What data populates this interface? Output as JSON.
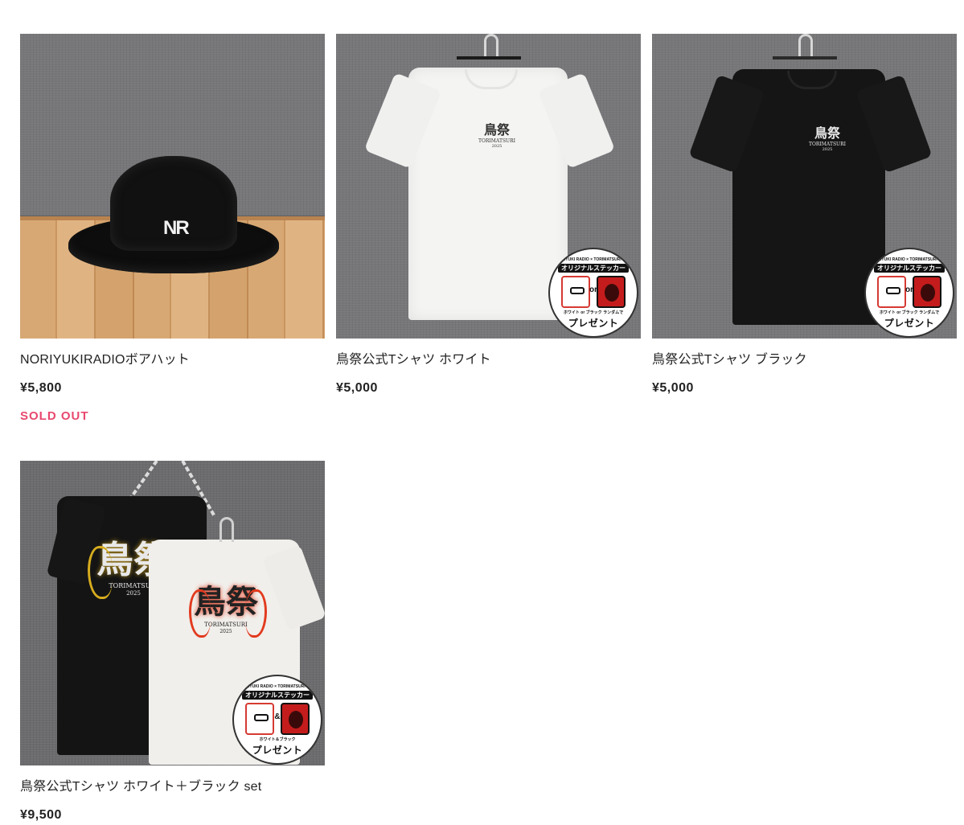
{
  "products": [
    {
      "title": "NORIYUKIRADIOボアハット",
      "price": "¥5,800",
      "status": "SOLD OUT",
      "image": {
        "hat_logo": "NR"
      }
    },
    {
      "title": "鳥祭公式Tシャツ ホワイト",
      "price": "¥5,000",
      "image": {
        "print_kanji": "鳥祭",
        "print_text": "TORIMATSURI",
        "print_year": "2025",
        "sticker": {
          "top": "NORIYUKI RADIO × TORIMATSURI 2025",
          "title": "オリジナルステッカー",
          "join": "or",
          "mini": "ホワイト or ブラック ランダムで",
          "present": "プレゼント"
        }
      }
    },
    {
      "title": "鳥祭公式Tシャツ ブラック",
      "price": "¥5,000",
      "image": {
        "print_kanji": "鳥祭",
        "print_text": "TORIMATSURI",
        "print_year": "2025",
        "sticker": {
          "top": "NORIYUKI RADIO × TORIMATSURI 2025",
          "title": "オリジナルステッカー",
          "join": "or",
          "mini": "ホワイト or ブラック ランダムで",
          "present": "プレゼント"
        }
      }
    },
    {
      "title": "鳥祭公式Tシャツ ホワイト＋ブラック set",
      "price": "¥9,500",
      "image": {
        "print_kanji": "鳥祭",
        "print_text": "TORIMATSURI",
        "print_year": "2025",
        "sticker": {
          "top": "NORIYUKI RADIO × TORIMATSURI 2025",
          "title": "オリジナルステッカー",
          "join": "&",
          "mini": "ホワイト＆ブラック",
          "present": "プレゼント"
        }
      }
    }
  ],
  "colors": {
    "sold_out": "#e8486e",
    "text": "#222222"
  }
}
